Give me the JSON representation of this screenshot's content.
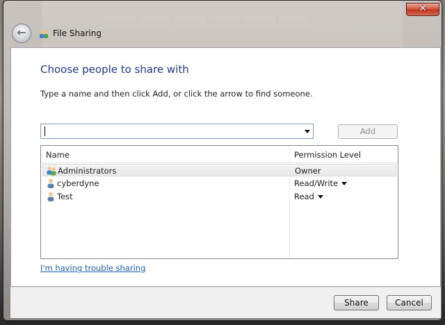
{
  "window": {
    "title": "File Sharing",
    "close_glyph": "✕",
    "back_glyph": "←"
  },
  "main": {
    "heading": "Choose people to share with",
    "instruction": "Type a name and then click Add, or click the arrow to find someone.",
    "name_input": {
      "value": ""
    },
    "add_label": "Add"
  },
  "list": {
    "columns": [
      "Name",
      "Permission Level"
    ],
    "rows": [
      {
        "name": "Administrators",
        "permission": "Owner",
        "icon": "group-icon",
        "has_dropdown": false,
        "selected": true
      },
      {
        "name": "cyberdyne",
        "permission": "Read/Write",
        "icon": "user-icon",
        "has_dropdown": true,
        "selected": false
      },
      {
        "name": "Test",
        "permission": "Read",
        "icon": "user-icon",
        "has_dropdown": true,
        "selected": false
      }
    ]
  },
  "help_link": "I'm having trouble sharing",
  "footer": {
    "share_label": "Share",
    "cancel_label": "Cancel"
  },
  "colors": {
    "heading": "#1e3a8a",
    "link": "#1a5fb4",
    "close": "#c0351f"
  }
}
